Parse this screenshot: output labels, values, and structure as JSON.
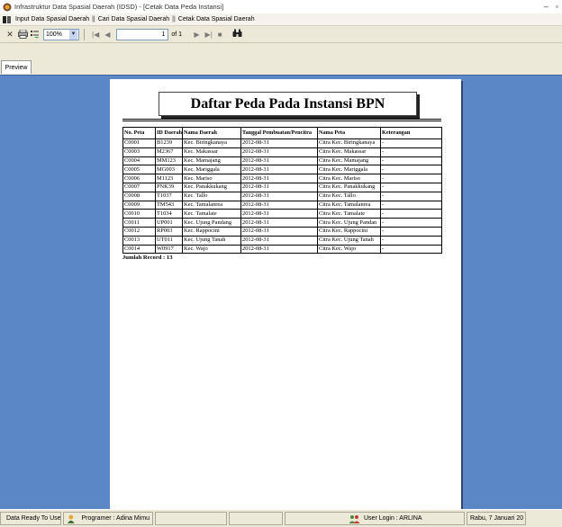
{
  "window": {
    "title": "Infrastruktur Data Spasial Daerah (IDSD) - [Cetak Data Peda Instansi]",
    "minimize_glyph": "–",
    "restore_glyph": "▫"
  },
  "menubar": {
    "items": [
      "Input Data Spasial Daerah",
      "Cari Data Spasial Daerah",
      "Cetak Data Spasial Daerah"
    ],
    "separator": "||"
  },
  "toolbar": {
    "close_glyph": "✕",
    "zoom_value": "100%",
    "page_current": "1",
    "page_of": "of 1",
    "find_glyph": "🔭"
  },
  "tabs": {
    "preview_label": "Preview"
  },
  "report": {
    "title": "Daftar Peda Pada Instansi BPN",
    "columns": [
      "No. Peta",
      "ID Daerah",
      "Nama Daerah",
      "Tanggal Pembuatan/Pencitra",
      "Nama Peta",
      "Keterangan"
    ],
    "rows": [
      [
        "C0001",
        "B1239",
        "Kec. Biringkanaya",
        "2012-08-31",
        "Citra Kec. Biringkanaya",
        "-"
      ],
      [
        "C0003",
        "M2367",
        "Kec. Makassar",
        "2012-08-31",
        "Citra Kec. Makassar",
        "-"
      ],
      [
        "C0004",
        "MM123",
        "Kec. Mamajang",
        "2012-08-31",
        "Citra Kec. Mamajang",
        "-"
      ],
      [
        "C0005",
        "MG003",
        "Kec. Mariggala",
        "2012-08-31",
        "Citra Kec. Mariggala",
        "-"
      ],
      [
        "C0006",
        "M1123",
        "Kec. Mariso",
        "2012-08-31",
        "Citra Kec. Mariso",
        "-"
      ],
      [
        "C0007",
        "PNK39",
        "Kec. Panakkukang",
        "2012-08-31",
        "Citra Kec. Panakkukang",
        "-"
      ],
      [
        "C0008",
        "T1037",
        "Kec. Tallo",
        "2012-08-31",
        "Citra Kec. Tallo",
        "-"
      ],
      [
        "C0009",
        "TM543",
        "Kec. Tamalanrea",
        "2012-08-31",
        "Citra Kec. Tamalanrea",
        "-"
      ],
      [
        "C0010",
        "T1034",
        "Kec. Tamalate",
        "2012-08-31",
        "Citra Kec. Tamalate",
        "-"
      ],
      [
        "C0011",
        "UP001",
        "Kec. Ujung Pandang",
        "2012-08-31",
        "Citra Kec. Ujung Pandan",
        "-"
      ],
      [
        "C0012",
        "RP003",
        "Kec. Rappocini",
        "2012-08-31",
        "Citra Kec. Rappocini",
        "-"
      ],
      [
        "C0013",
        "UT011",
        "Kec. Ujung Tanah",
        "2012-08-31",
        "Citra Kec. Ujung Tanah",
        "-"
      ],
      [
        "C0014",
        "W0917",
        "Kec. Wajo",
        "2012-08-31",
        "Citra Kec. Wajo",
        "-"
      ]
    ],
    "record_count": "Jumlah Record : 13"
  },
  "statusbar": {
    "status": "Data Ready To Use",
    "programmer": "Programer : Adina Mimu",
    "user": "User Login : ARLINA",
    "date": "Rabu, 7 Januari 20"
  },
  "colors": {
    "viewer_bg": "#5b87c7",
    "chrome": "#ece9d8"
  }
}
